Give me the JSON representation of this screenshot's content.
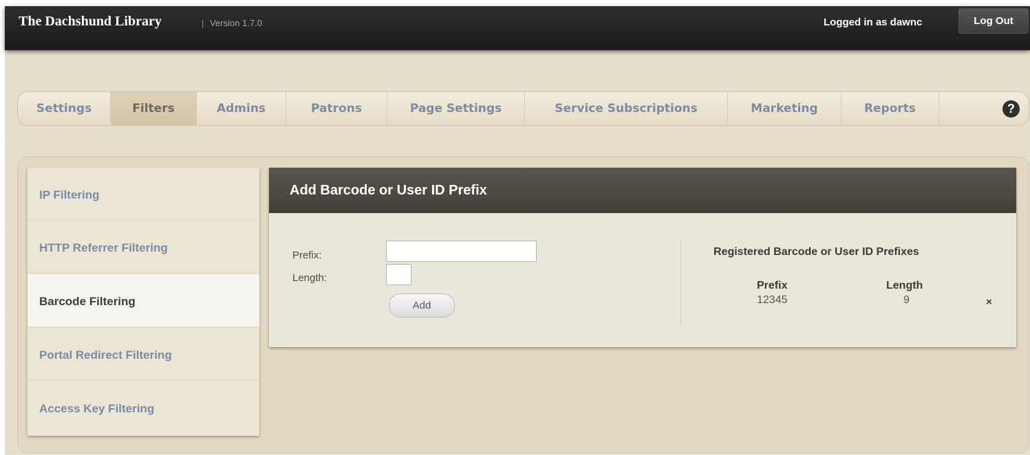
{
  "header": {
    "app_title": "The Dachshund Library",
    "version_separator": "|",
    "version": "Version 1.7.0",
    "logged_in_text": "Logged in as dawnc",
    "logout_label": "Log Out"
  },
  "main_nav": {
    "tabs": [
      {
        "label": "Settings"
      },
      {
        "label": "Filters",
        "active": true
      },
      {
        "label": "Admins"
      },
      {
        "label": "Patrons"
      },
      {
        "label": "Page Settings"
      },
      {
        "label": "Service Subscriptions"
      },
      {
        "label": "Marketing"
      },
      {
        "label": "Reports"
      }
    ],
    "help_icon": "?"
  },
  "sidebar": {
    "items": [
      {
        "label": "IP Filtering"
      },
      {
        "label": "HTTP Referrer Filtering"
      },
      {
        "label": "Barcode Filtering",
        "active": true
      },
      {
        "label": "Portal Redirect Filtering"
      },
      {
        "label": "Access Key Filtering"
      }
    ]
  },
  "form": {
    "title": "Add Barcode or User ID Prefix",
    "prefix_label": "Prefix:",
    "prefix_value": "",
    "length_label": "Length:",
    "length_value": "",
    "add_label": "Add"
  },
  "registered": {
    "title": "Registered Barcode or User ID Prefixes",
    "columns": [
      "Prefix",
      "Length"
    ],
    "rows": [
      {
        "prefix": "12345",
        "length": "9",
        "remove": "×"
      }
    ]
  },
  "colors": {
    "header_bg": "#1b1b1b",
    "page_bg": "#e7dfcb",
    "link_blue": "#7b8aa5",
    "panel_header": "#4b473f"
  }
}
